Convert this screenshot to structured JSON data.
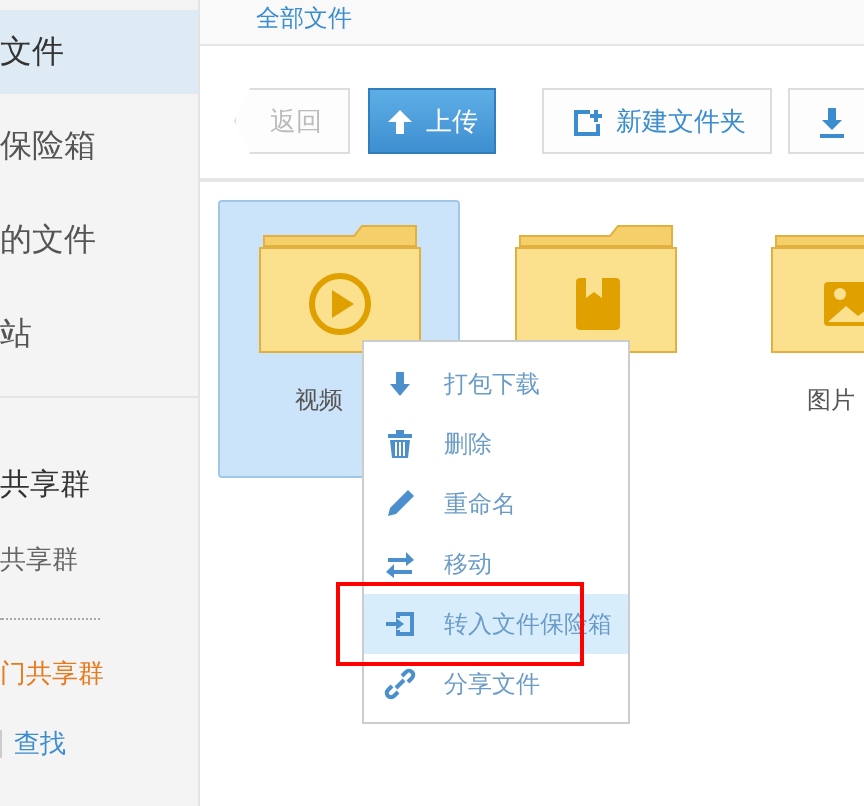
{
  "sidebar": {
    "items": [
      {
        "label": "文件",
        "selected": true
      },
      {
        "label": "保险箱",
        "selected": false
      },
      {
        "label": "的文件",
        "selected": false
      },
      {
        "label": "站",
        "selected": false
      }
    ],
    "groups_title": "共享群",
    "group_items": [
      {
        "label": "共享群",
        "kind": "plain"
      },
      {
        "label": "门共享群",
        "kind": "link"
      }
    ],
    "search_link": "查找"
  },
  "breadcrumb": "全部文件",
  "toolbar": [
    {
      "kind": "back",
      "label": "返回",
      "disabled": true
    },
    {
      "kind": "upload",
      "label": "上传"
    },
    {
      "kind": "new-folder",
      "label": "新建文件夹"
    },
    {
      "kind": "download"
    }
  ],
  "folders": [
    {
      "name": "视频",
      "kind": "video",
      "selected": true
    },
    {
      "kind": "book",
      "selected": false
    },
    {
      "name": "图片",
      "kind": "image",
      "selected": false
    }
  ],
  "context_menu": [
    {
      "kind": "download",
      "label": "打包下载",
      "selected": false
    },
    {
      "kind": "trash",
      "label": "删除",
      "selected": false
    },
    {
      "kind": "pencil",
      "label": "重命名",
      "selected": false
    },
    {
      "kind": "move",
      "label": "移动",
      "selected": false
    },
    {
      "kind": "vault",
      "label": "转入文件保险箱",
      "selected": true,
      "boxed": true
    },
    {
      "kind": "link",
      "label": "分享文件",
      "selected": false
    }
  ]
}
